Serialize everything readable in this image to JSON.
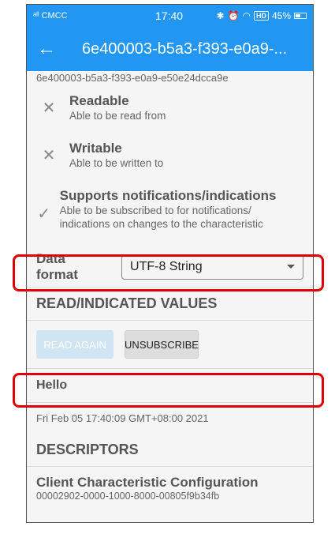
{
  "statusbar": {
    "carrier": "CMCC",
    "time": "17:40",
    "hd": "HD",
    "battery": "45%"
  },
  "appbar": {
    "title": "6e400003-b5a3-f393-e0a9-..."
  },
  "characteristic_uuid": "6e400003-b5a3-f393-e0a9-e50e24dcca9e",
  "properties": [
    {
      "icon": "close-icon",
      "title": "Readable",
      "sub": "Able to be read from"
    },
    {
      "icon": "close-icon",
      "title": "Writable",
      "sub": "Able to be written to"
    },
    {
      "icon": "check-icon",
      "title": "Supports notifications/indications",
      "sub": "Able to be subscribed to for notifications/ indications on changes to the characteristic"
    }
  ],
  "data_format": {
    "label": "Data format",
    "selected": "UTF-8 String"
  },
  "values_section": {
    "title": "READ/INDICATED VALUES",
    "read_again": "READ AGAIN",
    "unsubscribe": "UNSUBSCRIBE",
    "value": "Hello",
    "timestamp": "Fri Feb 05 17:40:09 GMT+08:00 2021"
  },
  "descriptors": {
    "title": "DESCRIPTORS",
    "items": [
      {
        "name": "Client Characteristic Configuration",
        "uuid": "00002902-0000-1000-8000-00805f9b34fb"
      }
    ]
  }
}
